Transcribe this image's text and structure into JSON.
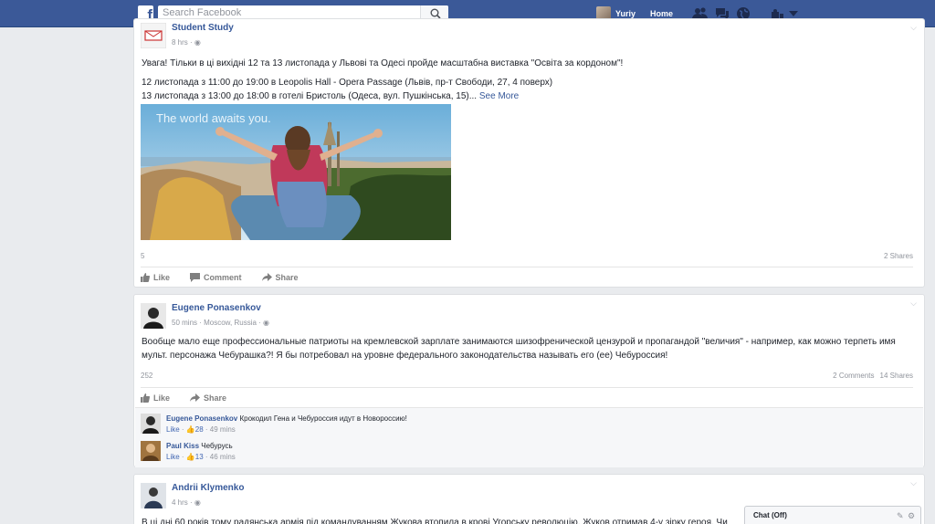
{
  "topbar": {
    "logo_letter": "f",
    "search_placeholder": "Search Facebook",
    "user_name": "Yuriy",
    "home_label": "Home"
  },
  "post1": {
    "author": "Student Study",
    "time": "8 hrs · ",
    "text_line1": "Увага! Тільки в ці вихідні 12 та 13 листопада у Львові та Одесі пройде масштабна виставка \"Освіта за кордоном\"!",
    "text_line2": "12 листопада з 11:00 до 19:00 в Leopolis Hall - Opera Passage (Львів, пр-т Свободи, 27, 4 поверх)",
    "text_line3": "13 листопада з 13:00 до 18:00 в готелі Бристоль (Одеса, вул. Пушкінська, 15)... ",
    "see_more": "See More",
    "photo_caption": "The world awaits you.",
    "likes_count": "5",
    "shares": "2 Shares",
    "actions": {
      "like": "Like",
      "comment": "Comment",
      "share": "Share"
    }
  },
  "post2": {
    "author": "Eugene Ponasenkov",
    "time": "50 mins · Moscow, Russia · ",
    "text_line1": "Вообще мало еще профессиональные патриоты на кремлевской зарплате занимаются шизофренической цензурой и пропагандой \"величия\" - например, как можно терпеть имя",
    "text_line2": "мульт. персонажа Чебурашка?! Я бы потребовал на уровне федерального законодательства называть его (ее) Чебуроссия!",
    "likes_count": "252",
    "comments_count": "2 Comments",
    "shares": "14 Shares",
    "actions": {
      "like": "Like",
      "share": "Share"
    },
    "comments": [
      {
        "name": "Eugene Ponasenkov",
        "text": "Крокодил Гена и Чебуроссия идут в Новороссию!",
        "like": "Like",
        "likes": "28",
        "time": "49 mins"
      },
      {
        "name": "Paul Kiss",
        "text": "Чебурусь",
        "like": "Like",
        "likes": "13",
        "time": "46 mins"
      }
    ]
  },
  "post3": {
    "author": "Andrii Klymenko",
    "time": "4 hrs · ",
    "text_line1": "В ці дні 60 років тому радянська армія під командуванням Жукова втопила в крові Угорську революцію. Жуков отримав 4-у зірку героя. Чи"
  },
  "chat": {
    "title": "Chat (Off)"
  },
  "colors": {
    "brand": "#3b5998",
    "link": "#365899",
    "background": "#e9ebee"
  }
}
